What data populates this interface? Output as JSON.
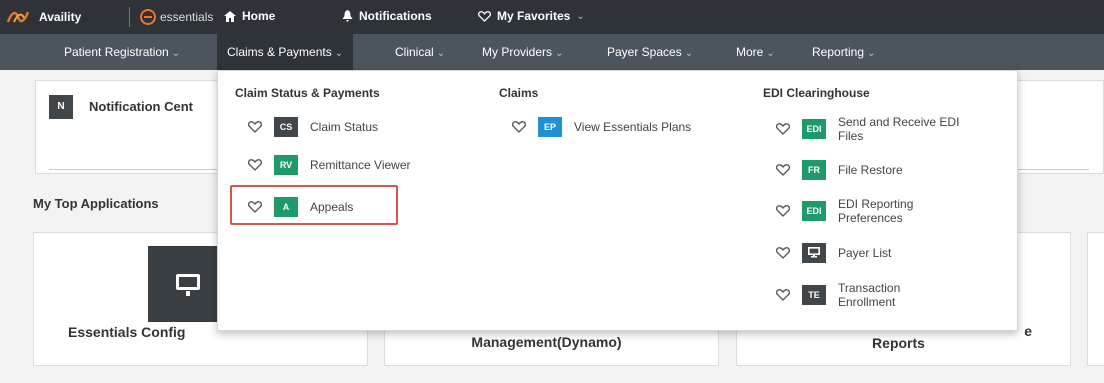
{
  "topbar": {
    "brand": "Availity",
    "essentials": "essentials",
    "home": "Home",
    "notifications": "Notifications",
    "favorites": "My Favorites"
  },
  "nav": {
    "items": [
      {
        "label": "Patient Registration"
      },
      {
        "label": "Claims & Payments"
      },
      {
        "label": "Clinical"
      },
      {
        "label": "My Providers"
      },
      {
        "label": "Payer Spaces"
      },
      {
        "label": "More"
      },
      {
        "label": "Reporting"
      }
    ],
    "active": "Claims & Payments"
  },
  "notification_center": {
    "badge": "N",
    "title": "Notification Cent"
  },
  "top_applications": {
    "title": "My Top Applications",
    "cards": [
      {
        "label": "Essentials Config"
      },
      {
        "label": "Management(Dynamo)"
      },
      {
        "label_line1": "e",
        "label_line2": "Reports"
      }
    ]
  },
  "dropdown": {
    "columns": [
      {
        "heading": "Claim Status & Payments",
        "items": [
          {
            "abbr": "CS",
            "label": "Claim Status"
          },
          {
            "abbr": "RV",
            "label": "Remittance Viewer"
          },
          {
            "abbr": "A",
            "label": "Appeals"
          }
        ]
      },
      {
        "heading": "Claims",
        "items": [
          {
            "abbr": "EP",
            "label": "View Essentials Plans"
          }
        ]
      },
      {
        "heading": "EDI Clearinghouse",
        "items": [
          {
            "abbr": "EDI",
            "label": "Send and Receive EDI Files"
          },
          {
            "abbr": "FR",
            "label": "File Restore"
          },
          {
            "abbr": "EDI",
            "label": "EDI Reporting Preferences"
          },
          {
            "abbr": "",
            "icon": "monitor-icon",
            "label": "Payer List"
          },
          {
            "abbr": "TE",
            "label": "Transaction Enrollment"
          }
        ]
      }
    ]
  },
  "colors": {
    "topbar": "#2f3338",
    "nav": "#4c545d",
    "tile_green": "#1f9a6b",
    "tile_blue": "#2191d6",
    "tile_dark": "#41464b",
    "highlight": "#d9534f",
    "brand_orange": "#e8762c"
  }
}
